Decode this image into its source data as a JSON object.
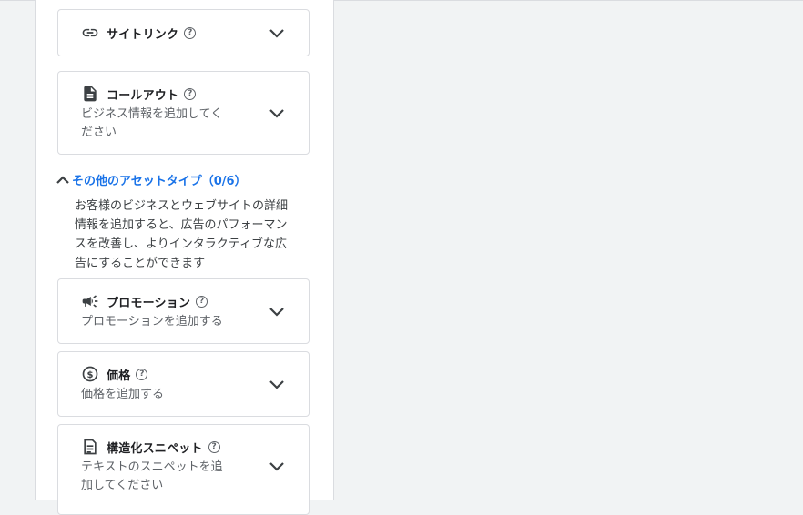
{
  "cards_top": [
    {
      "title": "サイトリンク",
      "description": "",
      "icon": "link-icon"
    },
    {
      "title": "コールアウト",
      "description": "ビジネス情報を追加してください",
      "desc_lines": [
        "ビジネス情報を追加してく",
        "ださい"
      ],
      "icon": "document-icon"
    }
  ],
  "section": {
    "title": "その他のアセットタイプ（0/6）",
    "description_lines": [
      "お客様のビジネスとウェブサイトの詳細",
      "情報を追加すると、広告のパフォーマン",
      "スを改善し、よりインタラクティブな広",
      "告にすることができます"
    ]
  },
  "cards_bottom": [
    {
      "title": "プロモーション",
      "description": "プロモーションを追加する",
      "icon": "megaphone-icon"
    },
    {
      "title": "価格",
      "description": "価格を追加する",
      "icon": "price-icon"
    },
    {
      "title": "構造化スニペット",
      "desc_lines": [
        "テキストのスニペットを追",
        "加してください"
      ],
      "icon": "snippet-icon"
    }
  ],
  "help_glyph": "?",
  "colors": {
    "accent": "#1a73e8",
    "text": "#202124",
    "secondary": "#5f6368",
    "border": "#dadce0",
    "background": "#f1f3f4"
  }
}
